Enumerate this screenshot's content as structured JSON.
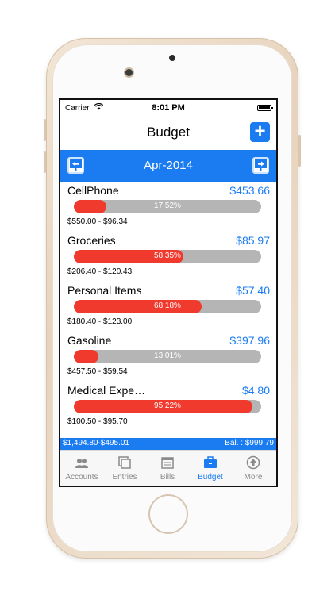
{
  "status": {
    "carrier": "Carrier",
    "time": "8:01 PM"
  },
  "nav": {
    "title": "Budget",
    "add_label": "+"
  },
  "month": "Apr-2014",
  "items": [
    {
      "name": "CellPhone",
      "amount": "$453.66",
      "percent_text": "17.52%",
      "percent": 17.52,
      "range": "$550.00 - $96.34"
    },
    {
      "name": "Groceries",
      "amount": "$85.97",
      "percent_text": "58.35%",
      "percent": 58.35,
      "range": "$206.40 - $120.43"
    },
    {
      "name": "Personal Items",
      "amount": "$57.40",
      "percent_text": "68.18%",
      "percent": 68.18,
      "range": "$180.40 - $123.00"
    },
    {
      "name": "Gasoline",
      "amount": "$397.96",
      "percent_text": "13.01%",
      "percent": 13.01,
      "range": "$457.50 - $59.54"
    },
    {
      "name": "Medical Expe…",
      "amount": "$4.80",
      "percent_text": "95.22%",
      "percent": 95.22,
      "range": "$100.50 - $95.70"
    }
  ],
  "summary": {
    "left": "$1,494.80-$495.01",
    "right": "Bal. : $999.79"
  },
  "tabs": [
    {
      "label": "Accounts",
      "icon": "accounts-icon"
    },
    {
      "label": "Entries",
      "icon": "entries-icon"
    },
    {
      "label": "Bills",
      "icon": "bills-icon"
    },
    {
      "label": "Budget",
      "icon": "budget-icon",
      "active": true
    },
    {
      "label": "More",
      "icon": "more-icon"
    }
  ],
  "colors": {
    "accent": "#1b7cf2",
    "bar_fill": "#f13a2e",
    "bar_track": "#b5b5b5"
  }
}
